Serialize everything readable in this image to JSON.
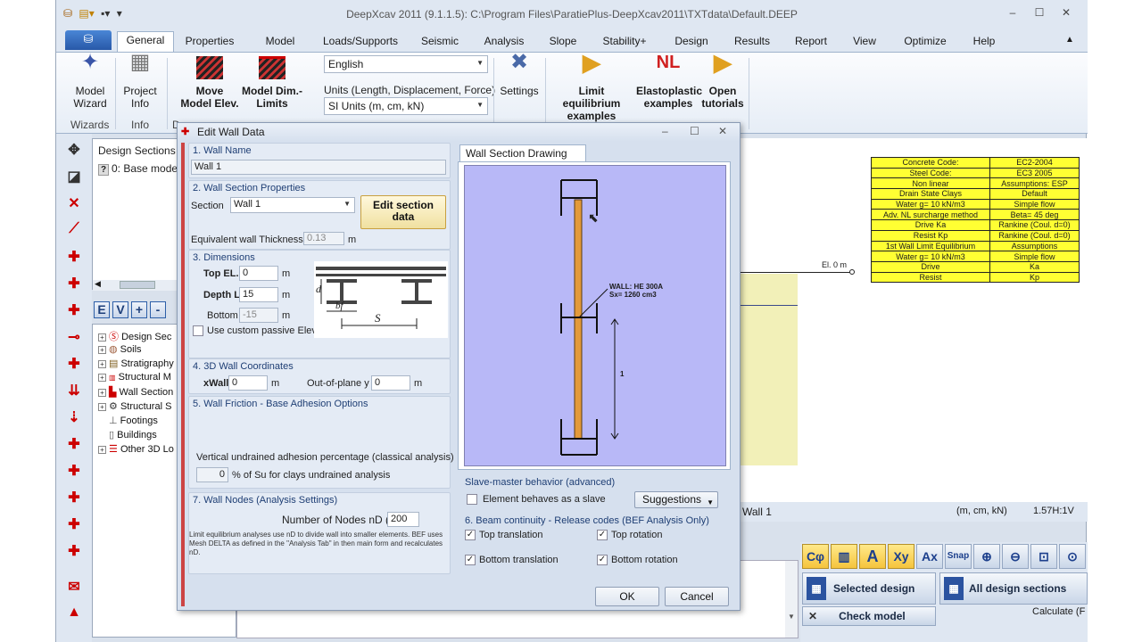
{
  "window": {
    "title": "DeepXcav 2011  (9.1.1.5): C:\\Program Files\\ParatiePlus-DeepXcav2011\\TXTdata\\Default.DEEP",
    "min": "–",
    "max": "☐",
    "close": "✕"
  },
  "menu": {
    "tabs": [
      "General",
      "Properties",
      "Model",
      "Loads/Supports",
      "Seismic",
      "Analysis",
      "Slope",
      "Stability+",
      "Design",
      "Results",
      "Report",
      "View",
      "Optimize",
      "Help"
    ]
  },
  "ribbon": {
    "model_wizard": "Model Wizard",
    "project_info": "Project Info",
    "move_model": "Move Model Elev.",
    "model_dim": "Model Dim.-Limits",
    "language": "English",
    "units_label": "Units (Length, Displacement, Force)",
    "units_value": "SI Units (m, cm, kN)",
    "settings": "Settings",
    "limit_eq": "Limit equilibrium examples",
    "elastoplastic": "Elastoplastic examples",
    "open_tutorials": "Open tutorials",
    "group_wizards": "Wizards",
    "group_info": "Info",
    "group_d": "D"
  },
  "left_panel": {
    "design_sections": "Design Sections",
    "base_model": "0: Base model",
    "ev_buttons": [
      "E",
      "V",
      "+",
      "-"
    ],
    "tree": [
      "Design Sec",
      "Soils",
      "Stratigraphy",
      "Structural M",
      "Wall Section",
      "Structural S",
      "Footings",
      "Buildings",
      "Other 3D Lo"
    ]
  },
  "canvas": {
    "el_label": "El. 0 m",
    "status_wall": "Wall 1",
    "status_units": "(m, cm, kN)",
    "status_scale": "1.57H:1V",
    "info_table": [
      [
        "Concrete Code:",
        "EC2-2004"
      ],
      [
        "Steel Code:",
        "EC3 2005"
      ],
      [
        "Non linear",
        "Assumptions: ESP"
      ],
      [
        "Drain State Clays",
        "Default"
      ],
      [
        "Water g= 10 kN/m3",
        "Simple flow"
      ],
      [
        "Adv. NL surcharge method",
        "Beta= 45 deg"
      ],
      [
        "Drive Ka",
        "Rankine (Coul. d=0)"
      ],
      [
        "Resist Kp",
        "Rankine (Coul. d=0)"
      ],
      [
        "1st Wall Limit Equilibrium",
        "Assumptions"
      ],
      [
        "Water g= 10 kN/m3",
        "Simple flow"
      ],
      [
        "Drive",
        "Ka"
      ],
      [
        "Resist",
        "Kp"
      ]
    ]
  },
  "toolbar_bottom": {
    "btns": [
      "Cφ",
      "",
      "A",
      "Xy",
      "Ax",
      "Snap",
      "",
      "",
      "",
      ""
    ],
    "selected_design": "Selected design",
    "all_sections": "All design sections",
    "check_model": "Check model",
    "calculate": "Calculate (F"
  },
  "dialog": {
    "title": "Edit Wall Data",
    "s1_header": "1. Wall Name",
    "wall_name": "Wall 1",
    "s2_header": "2. Wall Section Properties",
    "section_label": "Section",
    "section_value": "Wall 1",
    "edit_section": "Edit section data",
    "eq_thick_label": "Equivalent wall Thickness:",
    "eq_thick_value": "0.13",
    "eq_thick_unit": "m",
    "s3_header": "3. Dimensions",
    "top_el_label": "Top EL.",
    "top_el_value": "0",
    "depth_label": "Depth L",
    "depth_value": "15",
    "bottom_label": "Bottom",
    "bottom_value": "-15",
    "unit_m": "m",
    "custom_passive": "Use custom passive Elev.",
    "fig_d": "d",
    "fig_bf": "bf",
    "fig_s": "S",
    "s4_header": "4. 3D Wall Coordinates",
    "xwall_label": "xWall",
    "xwall_value": "0",
    "oop_label": "Out-of-plane y",
    "oop_value": "0",
    "s5_header": "5. Wall Friction - Base Adhesion Options",
    "vua_header": "Vertical undrained adhesion percentage (classical analysis)",
    "vua_value": "0",
    "vua_text": "% of Su for clays undrained analysis",
    "s7_header": "7. Wall Nodes (Analysis Settings)",
    "nodes_label": "Number of Nodes nD (0-",
    "nodes_value": "200",
    "nodes_note": "Limit equilibrium analyses use nD to divide wall into smaller elements. BEF uses Mesh DELTA as defined in the \"Analysis Tab\" in then main form and recalculates nD.",
    "drawing_tab": "Wall Section Drawing (Plan)",
    "wall_label": "WALL: HE 300A",
    "sx_label": "Sx= 1260 cm3",
    "dim_1": "1",
    "slave_header": "Slave-master behavior (advanced)",
    "slave_check": "Element behaves as a slave",
    "suggestions": "Suggestions",
    "s6_header": "6. Beam continuity - Release codes (BEF Analysis Only)",
    "top_translation": "Top translation",
    "top_rotation": "Top rotation",
    "bottom_translation": "Bottom translation",
    "bottom_rotation": "Bottom rotation",
    "ok": "OK",
    "cancel": "Cancel"
  }
}
